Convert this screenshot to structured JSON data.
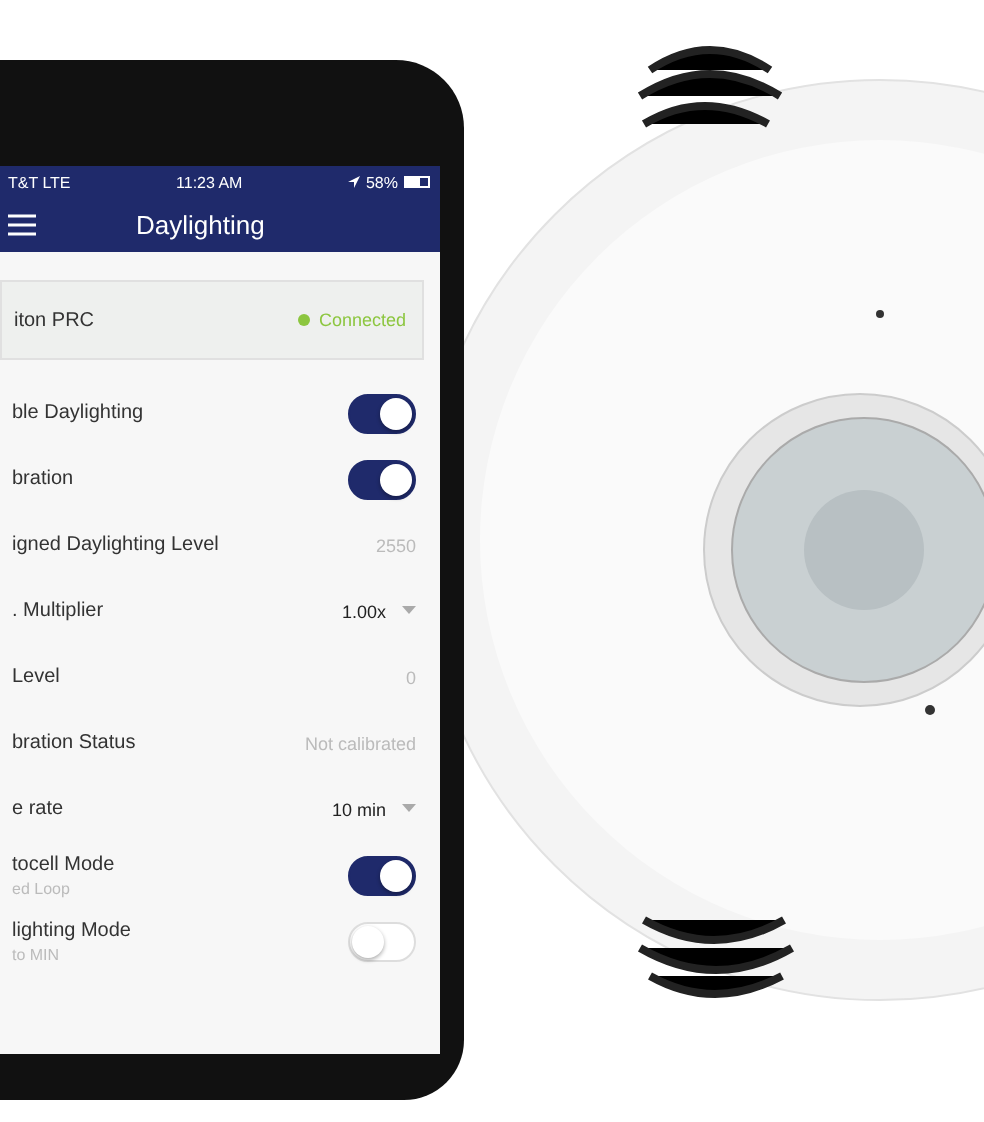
{
  "status_bar": {
    "carrier": "T&T  LTE",
    "time": "11:23 AM",
    "battery": "58%"
  },
  "nav_bar": {
    "title": "Daylighting"
  },
  "device": {
    "name": "iton PRC",
    "status": "Connected",
    "color": "#8cc63f"
  },
  "settings": [
    {
      "kind": "toggle",
      "label": "ble Daylighting",
      "on": true
    },
    {
      "kind": "toggle",
      "label": "bration",
      "on": true
    },
    {
      "kind": "value",
      "label": "igned Daylighting Level",
      "value": "2550"
    },
    {
      "kind": "select",
      "label": ". Multiplier",
      "value": "1.00x"
    },
    {
      "kind": "value",
      "label": " Level",
      "value": "0"
    },
    {
      "kind": "value",
      "label": "bration Status",
      "value": "Not calibrated"
    },
    {
      "kind": "select",
      "label": "e rate",
      "value": "10 min"
    },
    {
      "kind": "toggle",
      "label": "tocell Mode",
      "sublabel": "ed Loop",
      "on": true
    },
    {
      "kind": "toggle",
      "label": "lighting Mode",
      "sublabel": "to MIN",
      "on": false
    }
  ]
}
